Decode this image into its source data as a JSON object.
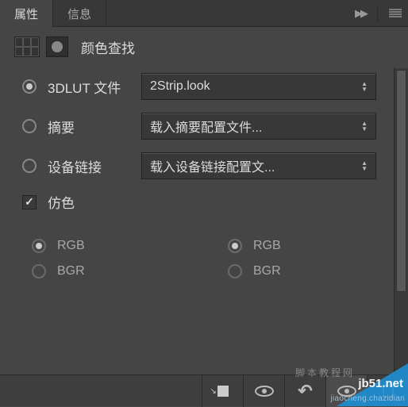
{
  "tabs": {
    "properties": "属性",
    "info": "信息"
  },
  "header": {
    "title": "颜色查找"
  },
  "options": {
    "lut3d": {
      "label": "3DLUT 文件",
      "value": "2Strip.look"
    },
    "abstract": {
      "label": "摘要",
      "value": "载入摘要配置文件..."
    },
    "devicelink": {
      "label": "设备链接",
      "value": "载入设备链接配置文..."
    },
    "dither": {
      "label": "仿色"
    }
  },
  "radiogrid": {
    "r1c1": "RGB",
    "r1c2": "RGB",
    "r2c1": "BGR",
    "r2c2": "BGR"
  },
  "watermark": {
    "brand": "jb51.net",
    "sub": "jiaocheng.chazidian",
    "over": "脚本教程网"
  }
}
